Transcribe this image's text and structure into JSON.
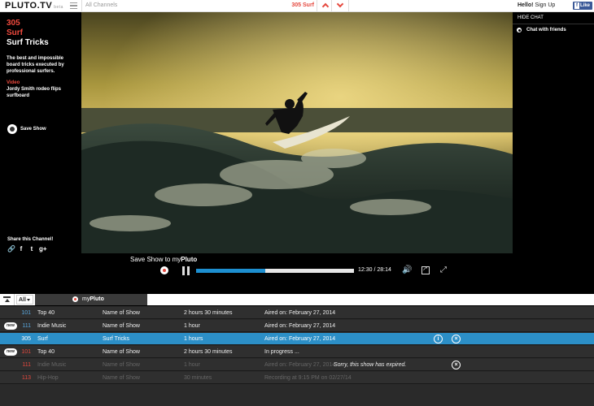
{
  "topbar": {
    "logo": "PLUTO.TV",
    "logo_tag": "beta",
    "channels_label": "All Channels",
    "now_playing": "305 Surf",
    "hello": "Hello!",
    "signup": "Sign Up",
    "fb_like": "Like"
  },
  "channel": {
    "number": "305",
    "name": "Surf",
    "show_title": "Surf Tricks",
    "description": "The best and impossible board tricks executed by professional surfers.",
    "video_label": "Video",
    "video_title": "Jordy Smith rodeo flips surfboard",
    "save_show": "Save Show",
    "share_label": "Share this Channel!"
  },
  "chat": {
    "hide_chat": "HIDE CHAT",
    "chat_with_friends": "Chat with friends"
  },
  "player": {
    "save_to_prefix": "Save Show to my",
    "save_to_brand": "Pluto",
    "time": "12:30 / 28:14",
    "progress": 0.44
  },
  "guide": {
    "all_tab": "All",
    "mypluto_prefix": "my",
    "mypluto_brand": "Pluto",
    "rows": [
      {
        "new": false,
        "num": "101",
        "num_red": false,
        "name": "Top 40",
        "show": "Name of Show",
        "duration": "2 hours 30 minutes",
        "status": "Aired on: February 27, 2014",
        "note": "",
        "selected": false,
        "faded": false,
        "info": false,
        "close": false
      },
      {
        "new": true,
        "num": "111",
        "num_red": false,
        "name": "Indie Music",
        "show": "Name of Show",
        "duration": "1 hour",
        "status": "Aired on: February 27, 2014",
        "note": "",
        "selected": false,
        "faded": false,
        "info": false,
        "close": false
      },
      {
        "new": false,
        "num": "305",
        "num_red": false,
        "name": "Surf",
        "show": "Surf Tricks",
        "duration": "1 hours",
        "status": "Aired on: February 27, 2014",
        "note": "",
        "selected": true,
        "faded": false,
        "info": true,
        "close": true
      },
      {
        "new": true,
        "num": "101",
        "num_red": true,
        "name": "Top 40",
        "show": "Name of Show",
        "duration": "2 hours 30 minutes",
        "status": "In progress ...",
        "note": "",
        "selected": false,
        "faded": false,
        "info": false,
        "close": false
      },
      {
        "new": false,
        "num": "111",
        "num_red": true,
        "name": "Indie Music",
        "show": "Name of Show",
        "duration": "1 hour",
        "status": "Aired on: February 27, 2014",
        "note": "Sorry, this show has expired.",
        "selected": false,
        "faded": true,
        "info": false,
        "close": true
      },
      {
        "new": false,
        "num": "113",
        "num_red": true,
        "name": "Hip-Hop",
        "show": "Name of Show",
        "duration": "30 minutes",
        "status": "Recording at 9:15 PM on 02/27/14",
        "note": "",
        "selected": false,
        "faded": true,
        "info": false,
        "close": false
      }
    ]
  },
  "icons": {
    "share": [
      "link-icon",
      "facebook-icon",
      "twitter-icon",
      "google-plus-icon"
    ],
    "player": [
      "record-icon",
      "pause-icon",
      "volume-icon",
      "popout-icon",
      "fullscreen-icon"
    ]
  },
  "colors": {
    "accent_red": "#e5483e",
    "progress_blue": "#1d8fd0",
    "selected_row": "#2c8fc7"
  }
}
